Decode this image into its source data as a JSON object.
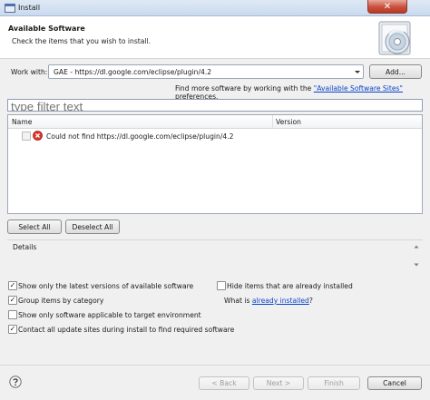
{
  "window": {
    "title": "Install",
    "close_glyph": "✕"
  },
  "banner": {
    "title": "Available Software",
    "description": "Check the items that you wish to install.",
    "icon": "install-cd-icon"
  },
  "work_with": {
    "label": "Work with:",
    "value": "GAE - https://dl.google.com/eclipse/plugin/4.2",
    "add_label": "Add..."
  },
  "find_more": {
    "prefix": "Find more software by working with the ",
    "link": "\"Available Software Sites\"",
    "suffix": " preferences."
  },
  "filter": {
    "placeholder": "type filter text"
  },
  "table": {
    "columns": [
      "Name",
      "Version"
    ],
    "rows": [
      {
        "name": "Could not find https://dl.google.com/eclipse/plugin/4.2",
        "version": "",
        "icon": "error-icon",
        "checked": false
      }
    ]
  },
  "buttons": {
    "select_all": "Select All",
    "deselect_all": "Deselect All"
  },
  "details": {
    "label": "Details"
  },
  "options": {
    "latest": {
      "label": "Show only the latest versions of available software",
      "checked": true
    },
    "group": {
      "label": "Group items by category",
      "checked": true
    },
    "target": {
      "label": "Show only software applicable to target environment",
      "checked": false
    },
    "contact": {
      "label": "Contact all update sites during install to find required software",
      "checked": true
    },
    "hide": {
      "label": "Hide items that are already installed",
      "checked": false
    },
    "what_is_prefix": "What is ",
    "what_is_link": "already installed",
    "what_is_suffix": "?"
  },
  "footer": {
    "back": "< Back",
    "next": "Next >",
    "finish": "Finish",
    "cancel": "Cancel"
  },
  "colors": {
    "link": "#0b45c8",
    "error": "#d9342b",
    "close_button": "#c9503b"
  }
}
